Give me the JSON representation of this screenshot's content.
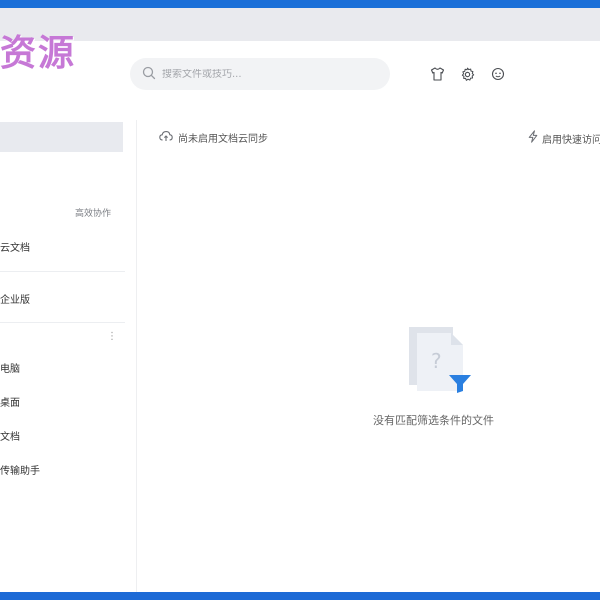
{
  "watermark": "资源",
  "search": {
    "placeholder": "搜索文件或技巧..."
  },
  "top_icons": [
    "shirt-icon",
    "gear-icon",
    "chat-icon"
  ],
  "sidebar": {
    "section_action": "高效协作",
    "items": [
      {
        "label": "云文档"
      },
      {
        "label": "企业版"
      },
      {
        "label": "电脑"
      },
      {
        "label": "桌面"
      },
      {
        "label": "文档"
      },
      {
        "label": "传输助手"
      }
    ]
  },
  "main": {
    "sync_status": "尚未启用文档云同步",
    "quick_access": "启用快速访问",
    "empty_message": "没有匹配筛选条件的文件"
  },
  "colors": {
    "accent_blue": "#2a7fe0",
    "title_bar": "#e9eaee",
    "selected_row": "#e8eaef"
  }
}
